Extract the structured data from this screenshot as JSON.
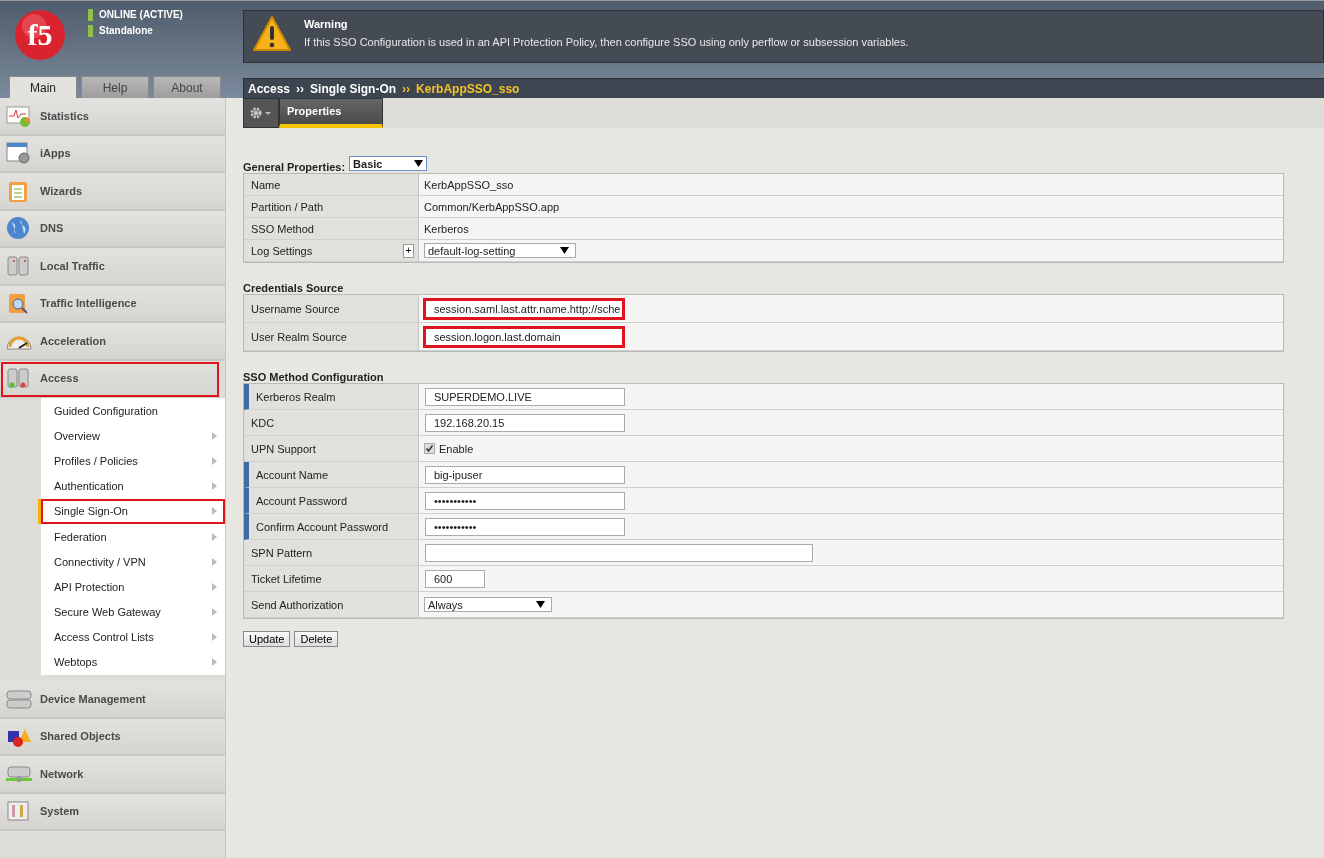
{
  "logo": "f5",
  "status": [
    {
      "label": "ONLINE (ACTIVE)"
    },
    {
      "label": "Standalone"
    }
  ],
  "warning": {
    "title": "Warning",
    "message": "If this SSO Configuration is used in an API Protection Policy, then configure SSO using only perflow or subsession variables."
  },
  "tabs": [
    {
      "label": "Main",
      "selected": true
    },
    {
      "label": "Help",
      "selected": false
    },
    {
      "label": "About",
      "selected": false
    }
  ],
  "nav": [
    {
      "label": "Statistics",
      "highlighted": false
    },
    {
      "label": "iApps",
      "highlighted": false
    },
    {
      "label": "Wizards",
      "highlighted": false
    },
    {
      "label": "DNS",
      "highlighted": false
    },
    {
      "label": "Local Traffic",
      "highlighted": false
    },
    {
      "label": "Traffic Intelligence",
      "highlighted": false
    },
    {
      "label": "Acceleration",
      "highlighted": false
    },
    {
      "label": "Access",
      "highlighted": true,
      "expanded": true,
      "children": [
        {
          "label": "Guided Configuration",
          "submenu": false,
          "selected": false,
          "highlighted": false
        },
        {
          "label": "Overview",
          "submenu": true,
          "selected": false,
          "highlighted": false
        },
        {
          "label": "Profiles / Policies",
          "submenu": true,
          "selected": false,
          "highlighted": false
        },
        {
          "label": "Authentication",
          "submenu": true,
          "selected": false,
          "highlighted": false
        },
        {
          "label": "Single Sign-On",
          "submenu": true,
          "selected": true,
          "highlighted": true
        },
        {
          "label": "Federation",
          "submenu": true,
          "selected": false,
          "highlighted": false
        },
        {
          "label": "Connectivity / VPN",
          "submenu": true,
          "selected": false,
          "highlighted": false
        },
        {
          "label": "API Protection",
          "submenu": true,
          "selected": false,
          "highlighted": false
        },
        {
          "label": "Secure Web Gateway",
          "submenu": true,
          "selected": false,
          "highlighted": false
        },
        {
          "label": "Access Control Lists",
          "submenu": true,
          "selected": false,
          "highlighted": false
        },
        {
          "label": "Webtops",
          "submenu": true,
          "selected": false,
          "highlighted": false
        }
      ]
    },
    {
      "label": "Device Management",
      "highlighted": false
    },
    {
      "label": "Shared Objects",
      "highlighted": false
    },
    {
      "label": "Network",
      "highlighted": false
    },
    {
      "label": "System",
      "highlighted": false
    }
  ],
  "breadcrumb": {
    "separator": "››",
    "items": [
      {
        "label": "Access",
        "current": false
      },
      {
        "label": "Single Sign-On",
        "current": false
      },
      {
        "label": "KerbAppSSO_sso",
        "current": true
      }
    ]
  },
  "page_tabs": [
    {
      "label": "Properties",
      "selected": true
    }
  ],
  "sections": [
    {
      "title": "General Properties:",
      "view": "Basic",
      "rows": [
        {
          "label": "Name",
          "kind": "text",
          "value": "KerbAppSSO_sso"
        },
        {
          "label": "Partition / Path",
          "kind": "text",
          "value": "Common/KerbAppSSO.app"
        },
        {
          "label": "SSO Method",
          "kind": "text",
          "value": "Kerberos"
        },
        {
          "label": "Log Settings",
          "kind": "select",
          "value": "default-log-setting",
          "add_button": "+"
        }
      ]
    },
    {
      "title": "Credentials Source",
      "rows": [
        {
          "label": "Username Source",
          "kind": "input",
          "value": "session.saml.last.attr.name.http://sche",
          "highlighted": true
        },
        {
          "label": "User Realm Source",
          "kind": "input",
          "value": "session.logon.last.domain",
          "highlighted": true
        }
      ]
    },
    {
      "title": "SSO Method Configuration",
      "rows": [
        {
          "label": "Kerberos Realm",
          "kind": "input",
          "value": "SUPERDEMO.LIVE",
          "required": true
        },
        {
          "label": "KDC",
          "kind": "input",
          "value": "192.168.20.15",
          "required": false
        },
        {
          "label": "UPN Support",
          "kind": "checkbox",
          "value": "Enable",
          "checked": true,
          "required": false
        },
        {
          "label": "Account Name",
          "kind": "input",
          "value": "big-ipuser",
          "required": true
        },
        {
          "label": "Account Password",
          "kind": "input",
          "value": "•••••••••••",
          "required": true
        },
        {
          "label": "Confirm Account Password",
          "kind": "input",
          "value": "•••••••••••",
          "required": true
        },
        {
          "label": "SPN Pattern",
          "kind": "wide-input",
          "value": "",
          "required": false
        },
        {
          "label": "Ticket Lifetime",
          "kind": "short-input",
          "value": "600",
          "required": false
        },
        {
          "label": "Send Authorization",
          "kind": "select",
          "value": "Always",
          "required": false
        }
      ]
    }
  ],
  "buttons": [
    "Update",
    "Delete"
  ]
}
